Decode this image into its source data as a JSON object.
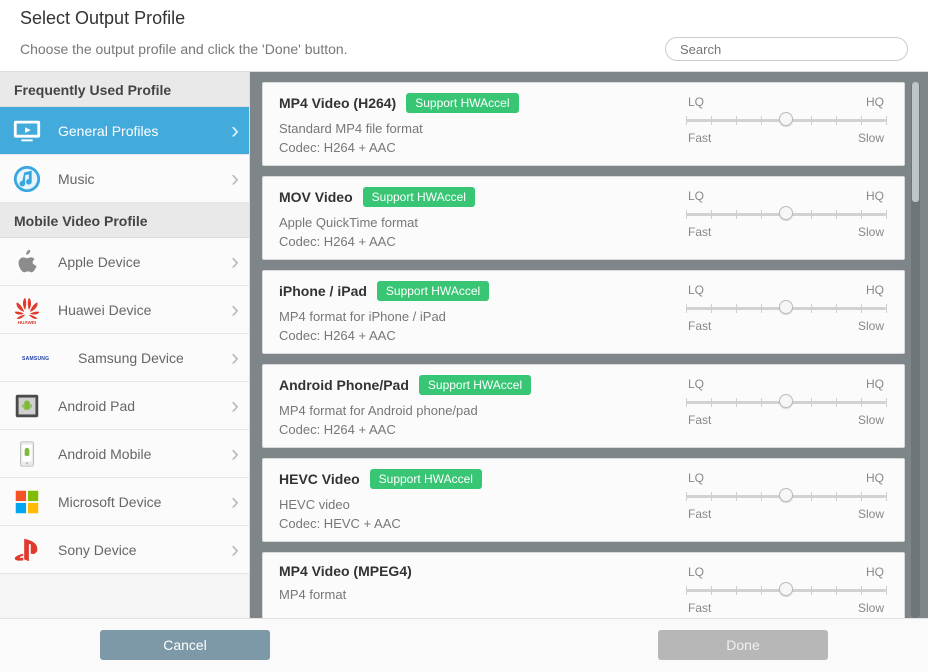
{
  "header": {
    "title": "Select Output Profile",
    "subtitle": "Choose the output profile and click the 'Done' button.",
    "search_placeholder": "Search"
  },
  "sidebar": {
    "section_freq": "Frequently Used Profile",
    "section_mobile": "Mobile Video Profile",
    "items": [
      {
        "label": "General Profiles",
        "icon": "monitor-icon",
        "selected": true
      },
      {
        "label": "Music",
        "icon": "music-icon",
        "selected": false
      },
      {
        "label": "Apple Device",
        "icon": "apple-icon",
        "selected": false
      },
      {
        "label": "Huawei Device",
        "icon": "huawei-icon",
        "selected": false
      },
      {
        "label": "Samsung Device",
        "icon": "samsung-icon",
        "selected": false
      },
      {
        "label": "Android Pad",
        "icon": "android-pad-icon",
        "selected": false
      },
      {
        "label": "Android Mobile",
        "icon": "android-mobile-icon",
        "selected": false
      },
      {
        "label": "Microsoft Device",
        "icon": "microsoft-icon",
        "selected": false
      },
      {
        "label": "Sony Device",
        "icon": "playstation-icon",
        "selected": false
      }
    ]
  },
  "slider": {
    "lq": "LQ",
    "hq": "HQ",
    "fast": "Fast",
    "slow": "Slow"
  },
  "profiles": [
    {
      "title": "MP4 Video (H264)",
      "badge": "Support HWAccel",
      "desc": "Standard MP4 file format",
      "codec": "Codec: H264 + AAC",
      "pos": 50
    },
    {
      "title": "MOV Video",
      "badge": "Support HWAccel",
      "desc": "Apple QuickTime format",
      "codec": "Codec: H264 + AAC",
      "pos": 50
    },
    {
      "title": "iPhone / iPad",
      "badge": "Support HWAccel",
      "desc": "MP4 format for iPhone / iPad",
      "codec": "Codec: H264 + AAC",
      "pos": 50
    },
    {
      "title": "Android Phone/Pad",
      "badge": "Support HWAccel",
      "desc": "MP4 format for Android phone/pad",
      "codec": "Codec: H264 + AAC",
      "pos": 50
    },
    {
      "title": "HEVC Video",
      "badge": "Support HWAccel",
      "desc": "HEVC video",
      "codec": "Codec: HEVC + AAC",
      "pos": 50
    },
    {
      "title": "MP4 Video (MPEG4)",
      "badge": "",
      "desc": "MP4 format",
      "codec": "",
      "pos": 50
    }
  ],
  "footer": {
    "cancel": "Cancel",
    "done": "Done"
  },
  "scroll": {
    "top": 0,
    "height": 120
  }
}
